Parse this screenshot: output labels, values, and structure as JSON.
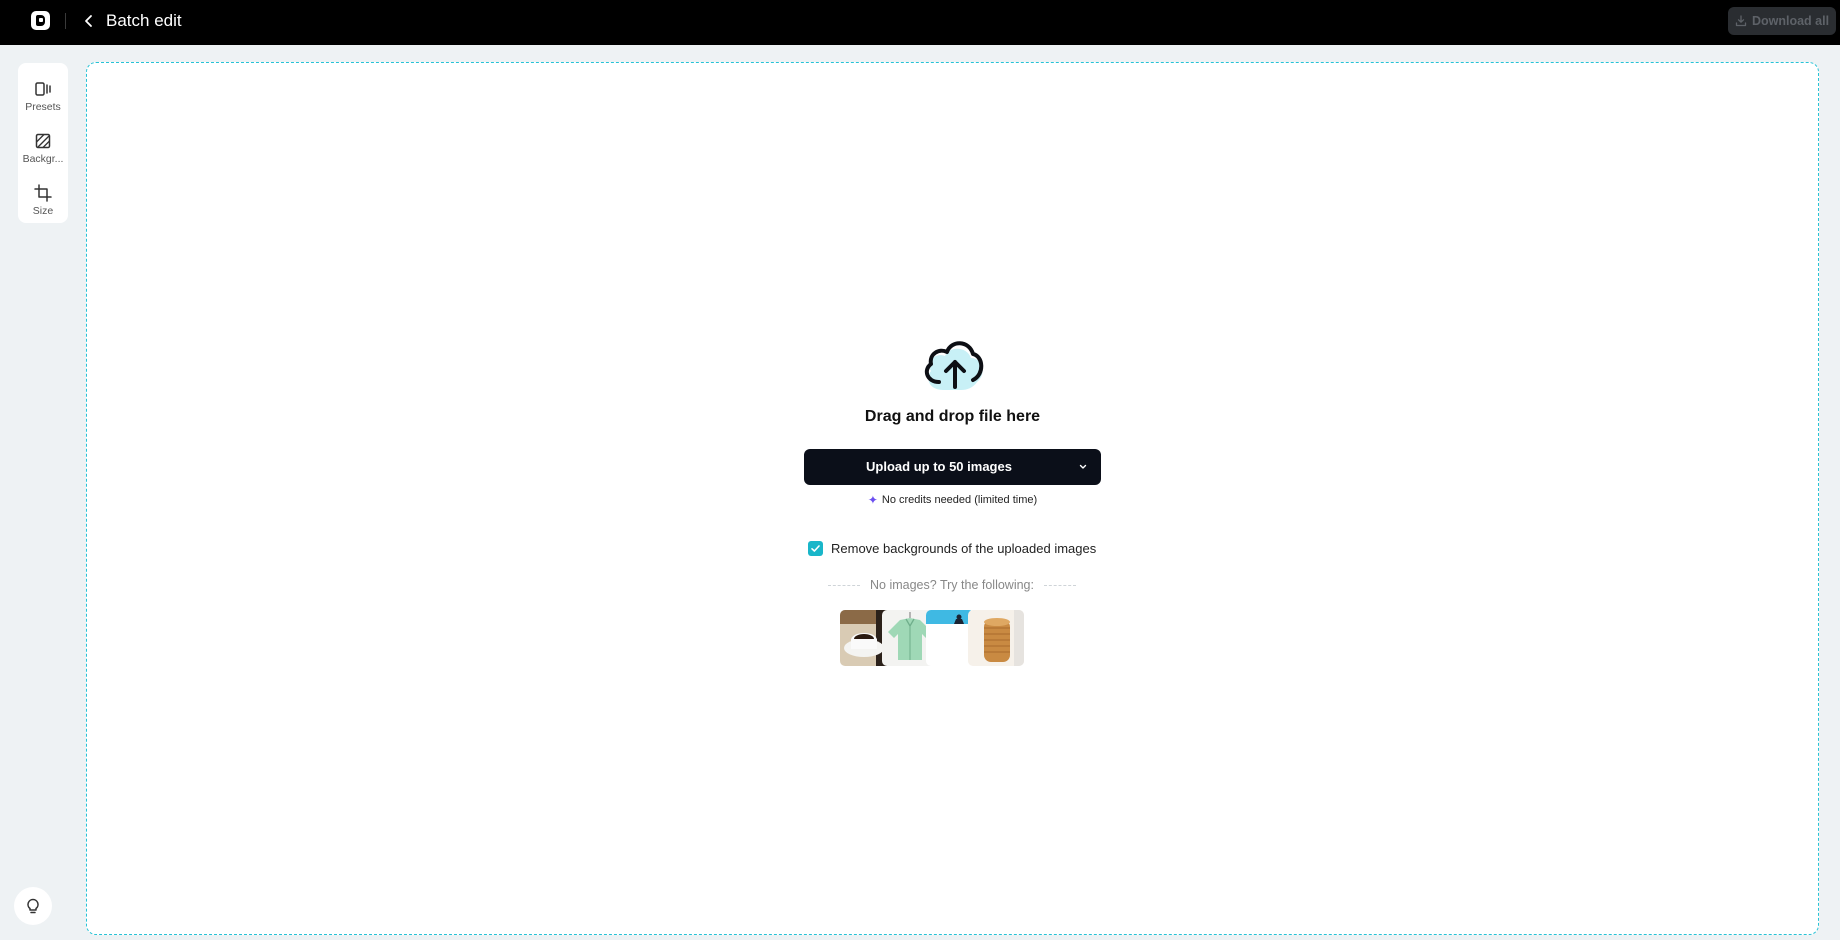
{
  "header": {
    "title": "Batch edit",
    "download_label": "Download all"
  },
  "sidebar": {
    "tools": [
      {
        "label": "Presets",
        "icon": "presets-icon"
      },
      {
        "label": "Backgr...",
        "icon": "background-icon"
      },
      {
        "label": "Size",
        "icon": "crop-icon"
      }
    ]
  },
  "upload": {
    "drag_text": "Drag and drop file here",
    "button_label": "Upload up to 50 images",
    "credits_note": "No credits needed (limited time)",
    "remove_bg_label": "Remove backgrounds of the uploaded images",
    "remove_bg_checked": true,
    "try_label": "No images? Try the following:",
    "samples": [
      "coffee-cup",
      "green-shirt",
      "person-on-blue",
      "cookies"
    ]
  },
  "colors": {
    "accent": "#19b6c9",
    "dropzone_border": "#27c3d6",
    "topbar": "#000000",
    "upload_button": "#0b0f19",
    "spark": "#6b4ff0"
  }
}
